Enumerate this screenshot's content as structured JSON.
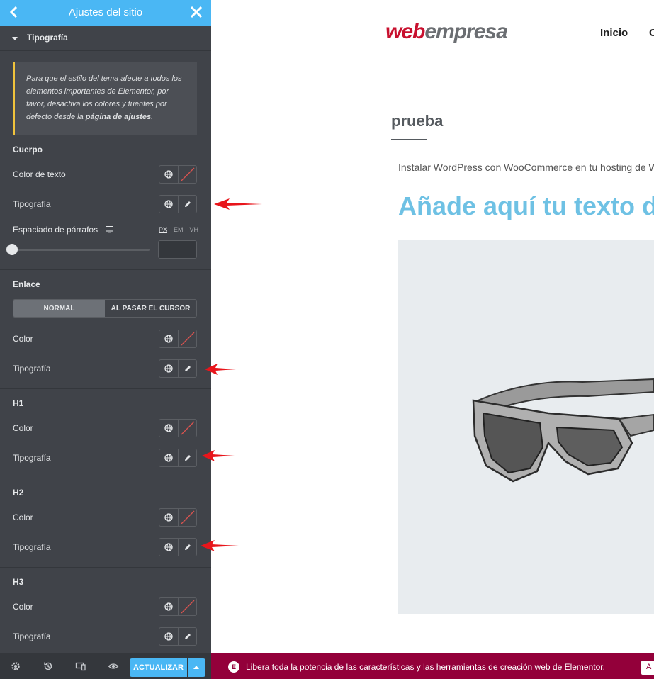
{
  "sidebar": {
    "header": {
      "title": "Ajustes del sitio"
    },
    "section": {
      "label": "Tipografía"
    },
    "notice": {
      "text": "Para que el estilo del tema afecte a todos los elementos importantes de Elementor, por favor, desactiva los colores y fuentes por defecto desde la ",
      "link": "página de ajustes",
      "end": "."
    },
    "body_group": {
      "title": "Cuerpo",
      "text_color_label": "Color de texto",
      "typography_label": "Tipografía",
      "paragraph_spacing_label": "Espaciado de párrafos",
      "units": [
        "PX",
        "EM",
        "VH"
      ]
    },
    "link_group": {
      "title": "Enlace",
      "tabs": [
        "NORMAL",
        "AL PASAR EL CURSOR"
      ],
      "color_label": "Color",
      "typography_label": "Tipografía"
    },
    "h1_group": {
      "title": "H1",
      "color_label": "Color",
      "typography_label": "Tipografía"
    },
    "h2_group": {
      "title": "H2",
      "color_label": "Color",
      "typography_label": "Tipografía"
    },
    "h3_group": {
      "title": "H3",
      "color_label": "Color",
      "typography_label": "Tipografía"
    },
    "footer": {
      "update_label": "ACTUALIZAR"
    }
  },
  "preview": {
    "logo": {
      "part1": "web",
      "part2": "empresa"
    },
    "nav": {
      "item1": "Inicio",
      "item2": "C"
    },
    "post_title": "prueba",
    "excerpt": {
      "text": "Instalar WordPress con WooCommerce en tu hosting de ",
      "link": "W"
    },
    "heading": "Añade aquí tu texto de"
  },
  "banner": {
    "icon": "E",
    "text": "Libera toda la potencia de las características y las herramientas de creación web de Elementor.",
    "button": "A"
  },
  "colors": {
    "sidebar_bg": "#404349",
    "accent_blue": "#4ab7f4",
    "banner": "#93003a",
    "heading_blue": "#6ec1e4",
    "notice_border": "#f0c33c",
    "arrow_red": "#e8151b"
  }
}
